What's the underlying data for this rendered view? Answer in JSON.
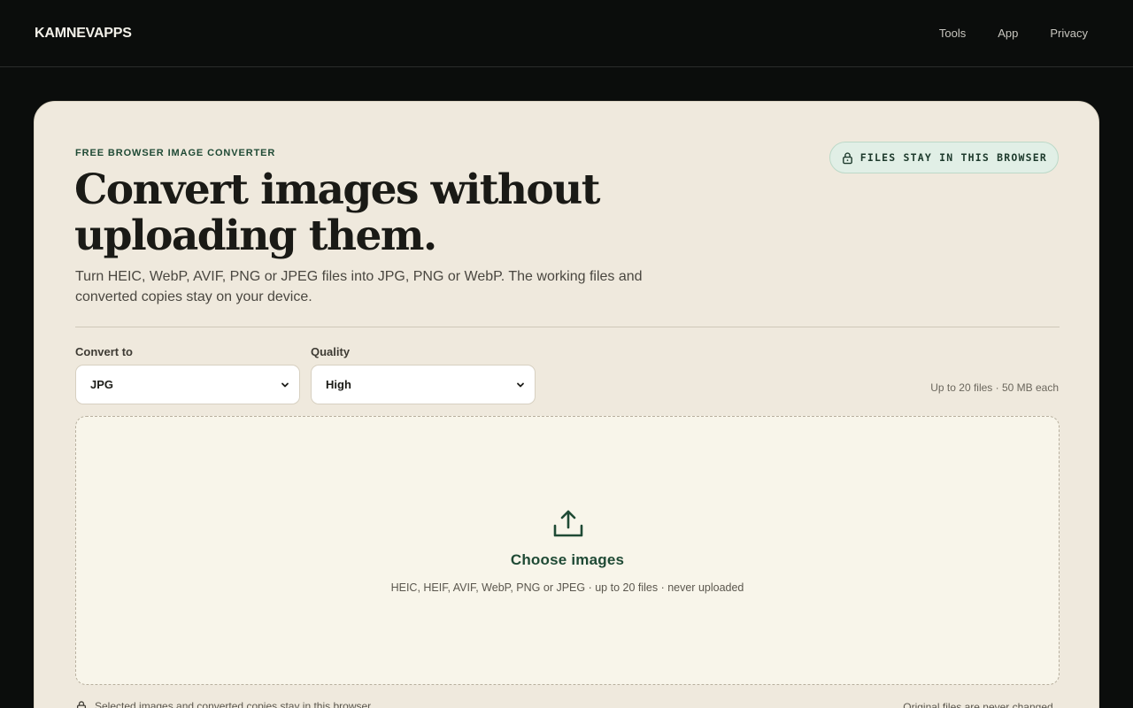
{
  "nav": {
    "brand": "KAMNEVAPPS",
    "links": [
      "Tools",
      "App",
      "Privacy"
    ]
  },
  "hero": {
    "eyebrow": "FREE BROWSER IMAGE CONVERTER",
    "badge": "FILES STAY IN THIS BROWSER",
    "headline_line1": "Convert images without",
    "headline_line2": "uploading them.",
    "subtitle": "Turn HEIC, WebP, AVIF, PNG or JPEG files into JPG, PNG or WebP. The working files and converted copies stay on your device."
  },
  "controls": {
    "convert_label": "Convert to",
    "convert_value": "JPG",
    "quality_label": "Quality",
    "quality_value": "High",
    "limits": "Up to 20 files · 50 MB each"
  },
  "dropzone": {
    "title": "Choose images",
    "subtitle": "HEIC, HEIF, AVIF, WebP, PNG or JPEG · up to 20 files · never uploaded"
  },
  "footer": {
    "left": "Selected images and converted copies stay in this browser.",
    "right": "Original files are never changed."
  },
  "colors": {
    "accent": "#1f4a35",
    "card_bg": "#efe9dd",
    "page_bg": "#0b0d0c",
    "badge_bg": "#e1efe6"
  },
  "icons": {
    "badge": "lock-icon",
    "dropzone": "upload-icon",
    "footer": "lock-icon",
    "select": "chevron-down-icon"
  }
}
